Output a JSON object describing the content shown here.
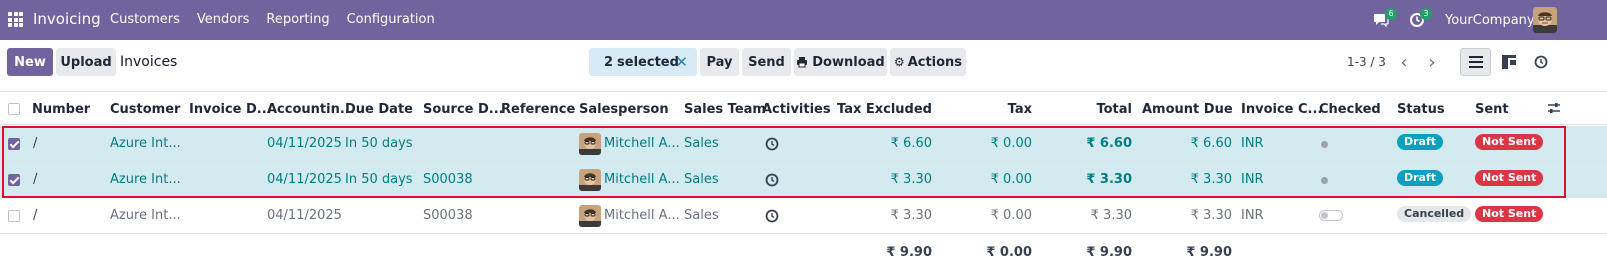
{
  "navbar": {
    "app_name": "Invoicing",
    "menu": [
      "Customers",
      "Vendors",
      "Reporting",
      "Configuration"
    ],
    "messages_count": "6",
    "activities_count": "3",
    "company": "YourCompany"
  },
  "control_panel": {
    "new_label": "New",
    "upload_label": "Upload",
    "breadcrumb": "Invoices",
    "selected_count": "2",
    "selected_text": "selected",
    "pay_label": "Pay",
    "send_label": "Send",
    "download_label": "Download",
    "actions_label": "Actions",
    "pager": "1-3 / 3"
  },
  "columns": {
    "number": "Number",
    "customer": "Customer",
    "invoice_date": "Invoice D...",
    "accounting_date": "Accountin...",
    "due_date": "Due Date",
    "source_doc": "Source D...",
    "reference": "Reference",
    "salesperson": "Salesperson",
    "sales_team": "Sales Team",
    "activities": "Activities",
    "tax_excluded": "Tax Excluded",
    "tax": "Tax",
    "total": "Total",
    "amount_due": "Amount Due",
    "invoice_currency": "Invoice C...",
    "checked": "Checked",
    "status": "Status",
    "sent": "Sent"
  },
  "rows": [
    {
      "selected": true,
      "number": "/",
      "customer": "Azure Int...",
      "accounting_date": "04/11/2025",
      "due_date": "In 50 days",
      "source_doc": "",
      "salesperson": "Mitchell A...",
      "sales_team": "Sales",
      "tax_excluded": "₹ 6.60",
      "tax": "₹ 0.00",
      "total": "₹ 6.60",
      "amount_due": "₹ 6.60",
      "currency": "INR",
      "status": "Draft",
      "sent": "Not Sent"
    },
    {
      "selected": true,
      "number": "/",
      "customer": "Azure Int...",
      "accounting_date": "04/11/2025",
      "due_date": "In 50 days",
      "source_doc": "S00038",
      "salesperson": "Mitchell A...",
      "sales_team": "Sales",
      "tax_excluded": "₹ 3.30",
      "tax": "₹ 0.00",
      "total": "₹ 3.30",
      "amount_due": "₹ 3.30",
      "currency": "INR",
      "status": "Draft",
      "sent": "Not Sent"
    },
    {
      "selected": false,
      "number": "/",
      "customer": "Azure Int...",
      "accounting_date": "04/11/2025",
      "due_date": "",
      "source_doc": "S00038",
      "salesperson": "Mitchell A...",
      "sales_team": "Sales",
      "tax_excluded": "₹ 3.30",
      "tax": "₹ 0.00",
      "total": "₹ 3.30",
      "amount_due": "₹ 3.30",
      "currency": "INR",
      "status": "Cancelled",
      "sent": "Not Sent"
    }
  ],
  "totals": {
    "tax_excluded": "₹ 9.90",
    "tax": "₹ 0.00",
    "total": "₹ 9.90",
    "amount_due": "₹ 9.90"
  },
  "colors": {
    "brand": "#71639e",
    "selected_row": "#d3eaf0",
    "link": "#017e84",
    "draft": "#0c9fbf",
    "not_sent": "#dc3545",
    "highlight": "#e0102a"
  }
}
